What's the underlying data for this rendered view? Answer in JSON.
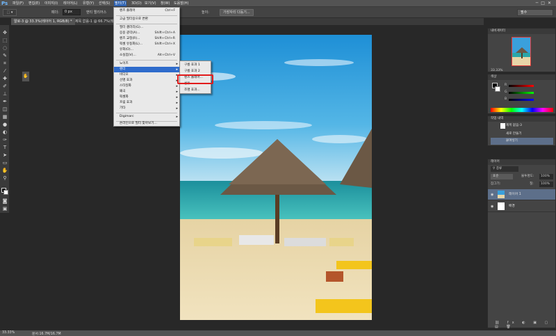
{
  "app": {
    "logo": "Ps"
  },
  "menu": [
    {
      "label": "파일(F)"
    },
    {
      "label": "편집(E)"
    },
    {
      "label": "이미지(I)"
    },
    {
      "label": "레이어(L)"
    },
    {
      "label": "유형(Y)"
    },
    {
      "label": "선택(S)"
    },
    {
      "label": "필터(T)"
    },
    {
      "label": "3D(D)"
    },
    {
      "label": "보기(V)"
    },
    {
      "label": "창(W)"
    },
    {
      "label": "도움말(H)"
    }
  ],
  "options": {
    "feather_label": "페더:",
    "feather_value": "0 px",
    "antialias_label": "앤티 앨리어스",
    "width_label": "높이:",
    "refine_edge": "가장자리 다듬기...",
    "workspace": "필수"
  },
  "tabs": [
    {
      "label": "알로-3 @ 33.3%(레이어 1, RGB/8) *"
    },
    {
      "label": "제목 없음-1 @ 66.7%(레이어 1, RGB/8) *"
    }
  ],
  "filter_menu": {
    "items": [
      {
        "label": "렌즈 플레어",
        "shortcut": "Ctrl+F"
      },
      {
        "label": "고급 필터용으로 변환"
      },
      {
        "label": "필터 갤러리(G)..."
      },
      {
        "label": "응용 광각(A)...",
        "shortcut": "Shift+Ctrl+A"
      },
      {
        "label": "렌즈 교정(R)...",
        "shortcut": "Shift+Ctrl+R"
      },
      {
        "label": "픽셀 유동화(L)...",
        "shortcut": "Shift+Ctrl+X"
      },
      {
        "label": "유화(O)..."
      },
      {
        "label": "소실점(V)...",
        "shortcut": "Alt+Ctrl+V"
      },
      {
        "label": "노이즈"
      },
      {
        "label": "렌더"
      },
      {
        "label": "비디오"
      },
      {
        "label": "선명 효과"
      },
      {
        "label": "스타일화"
      },
      {
        "label": "왜곡"
      },
      {
        "label": "픽셀화"
      },
      {
        "label": "흐림 효과"
      },
      {
        "label": "기타"
      },
      {
        "label": "Digimarc"
      },
      {
        "label": "온라인으로 필터 찾아보기..."
      }
    ],
    "render_submenu": [
      {
        "label": "구름 효과 1"
      },
      {
        "label": "구름 효과 2"
      },
      {
        "label": "렌즈 플레어..."
      },
      {
        "label": "섬유..."
      },
      {
        "label": "조명 효과..."
      }
    ]
  },
  "panels": {
    "navigator": {
      "title": "내비게이터",
      "zoom": "33.33%"
    },
    "color": {
      "title": "색상",
      "r": "R",
      "g": "G",
      "b": "B"
    },
    "history": {
      "title": "작업 내역",
      "items": [
        {
          "label": "제목 없음-3"
        },
        {
          "label": "새로 만들기"
        },
        {
          "label": "붙여넣기"
        }
      ]
    },
    "layers": {
      "title": "레이어",
      "kind": "종류",
      "blend": "표준",
      "opacity_label": "불투명도:",
      "opacity": "100%",
      "lock_label": "잠그기:",
      "fill_label": "칠:",
      "fill": "100%",
      "items": [
        {
          "label": "레이어 1"
        },
        {
          "label": "배경"
        }
      ]
    }
  },
  "status": {
    "zoom": "33.33%",
    "doc": "문서:16.7M/16.7M"
  },
  "colors": {
    "accent": "#2f6ccc",
    "highlight": "#e21b1b"
  }
}
